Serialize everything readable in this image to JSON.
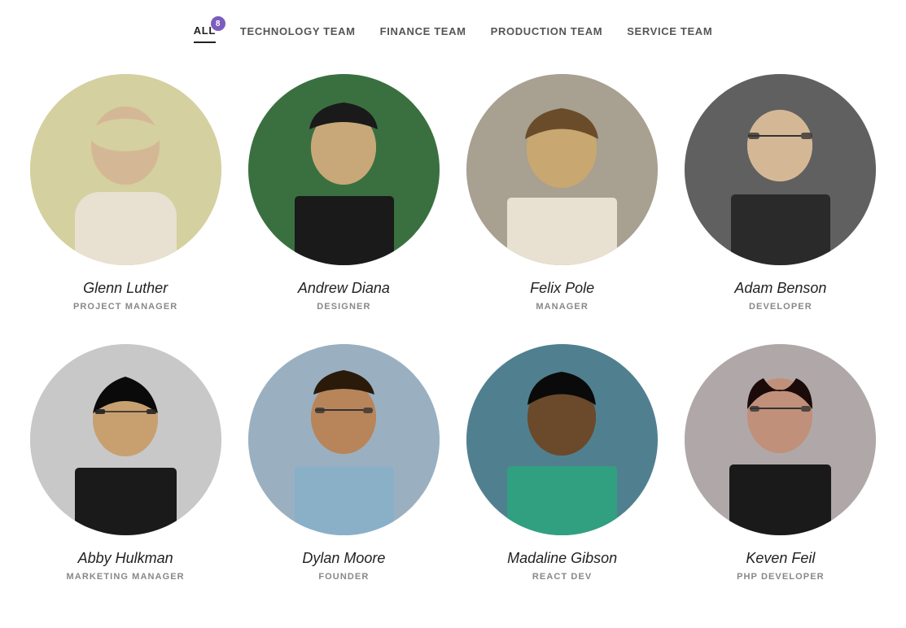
{
  "nav": {
    "tabs": [
      {
        "id": "all",
        "label": "ALL",
        "active": true,
        "badge": "8"
      },
      {
        "id": "technology",
        "label": "TECHNOLOGY TEAM",
        "active": false
      },
      {
        "id": "finance",
        "label": "FINANCE TEAM",
        "active": false
      },
      {
        "id": "production",
        "label": "PRODUCTION TEAM",
        "active": false
      },
      {
        "id": "service",
        "label": "SERVICE TEAM",
        "active": false
      }
    ]
  },
  "team": {
    "members": [
      {
        "id": 1,
        "name": "Glenn Luther",
        "role": "PROJECT MANAGER",
        "avatar_color": "#d4d0a0",
        "avatar_bg": "avatar-1"
      },
      {
        "id": 2,
        "name": "Andrew Diana",
        "role": "DESIGNER",
        "avatar_color": "#3a7040",
        "avatar_bg": "avatar-2"
      },
      {
        "id": 3,
        "name": "Felix Pole",
        "role": "MANAGER",
        "avatar_color": "#b0a898",
        "avatar_bg": "avatar-3"
      },
      {
        "id": 4,
        "name": "Adam Benson",
        "role": "DEVELOPER",
        "avatar_color": "#707070",
        "avatar_bg": "avatar-4"
      },
      {
        "id": 5,
        "name": "Abby Hulkman",
        "role": "MARKETING MANAGER",
        "avatar_color": "#d0d0d0",
        "avatar_bg": "avatar-5"
      },
      {
        "id": 6,
        "name": "Dylan Moore",
        "role": "FOUNDER",
        "avatar_color": "#a0b8cc",
        "avatar_bg": "avatar-6"
      },
      {
        "id": 7,
        "name": "Madaline Gibson",
        "role": "REACT DEV",
        "avatar_color": "#4a8090",
        "avatar_bg": "avatar-7"
      },
      {
        "id": 8,
        "name": "Keven Feil",
        "role": "PHP DEVELOPER",
        "avatar_color": "#c0c0c0",
        "avatar_bg": "avatar-8"
      }
    ]
  }
}
